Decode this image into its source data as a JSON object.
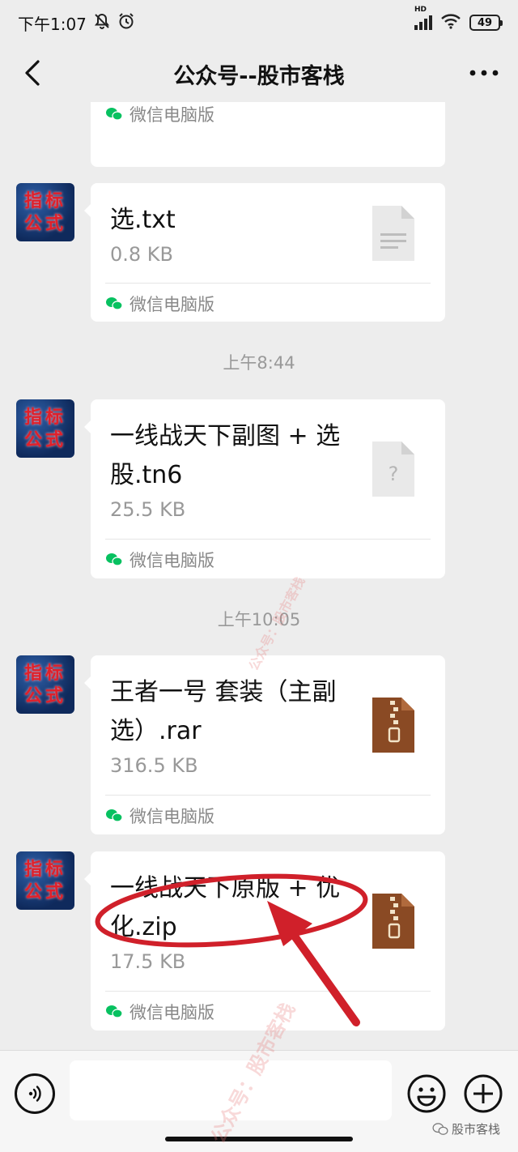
{
  "status_bar": {
    "time": "下午1:07",
    "network": "HD",
    "battery": "49"
  },
  "nav": {
    "title": "公众号--股市客栈"
  },
  "avatar": {
    "line1": "指标",
    "line2": "公式"
  },
  "messages": [
    {
      "name": "",
      "size": "",
      "source": "微信电脑版",
      "icon": "file-icon"
    },
    {
      "name": "选.txt",
      "size": "0.8 KB",
      "source": "微信电脑版",
      "icon": "text-document-icon"
    },
    {
      "name": "一线战天下副图 + 选股.tn6",
      "size": "25.5 KB",
      "source": "微信电脑版",
      "icon": "unknown-file-icon"
    },
    {
      "name": "王者一号 套装（主副选）.rar",
      "size": "316.5 KB",
      "source": "微信电脑版",
      "icon": "archive-file-icon"
    },
    {
      "name": "一线战天下原版 + 优化.zip",
      "size": "17.5 KB",
      "source": "微信电脑版",
      "icon": "archive-file-icon"
    }
  ],
  "timestamps": [
    "上午8:44",
    "上午10:05"
  ],
  "input_bar": {
    "placeholder": ""
  },
  "watermark": {
    "bottom_label": "股市客栈",
    "diagonal_1": "公众号：股市客栈",
    "diagonal_2": "公众号：股市客栈"
  },
  "colors": {
    "background": "#ededed",
    "card": "#ffffff",
    "archive_icon": "#8a4a24",
    "annotation": "#d0202a",
    "wechat_green": "#07c160"
  }
}
